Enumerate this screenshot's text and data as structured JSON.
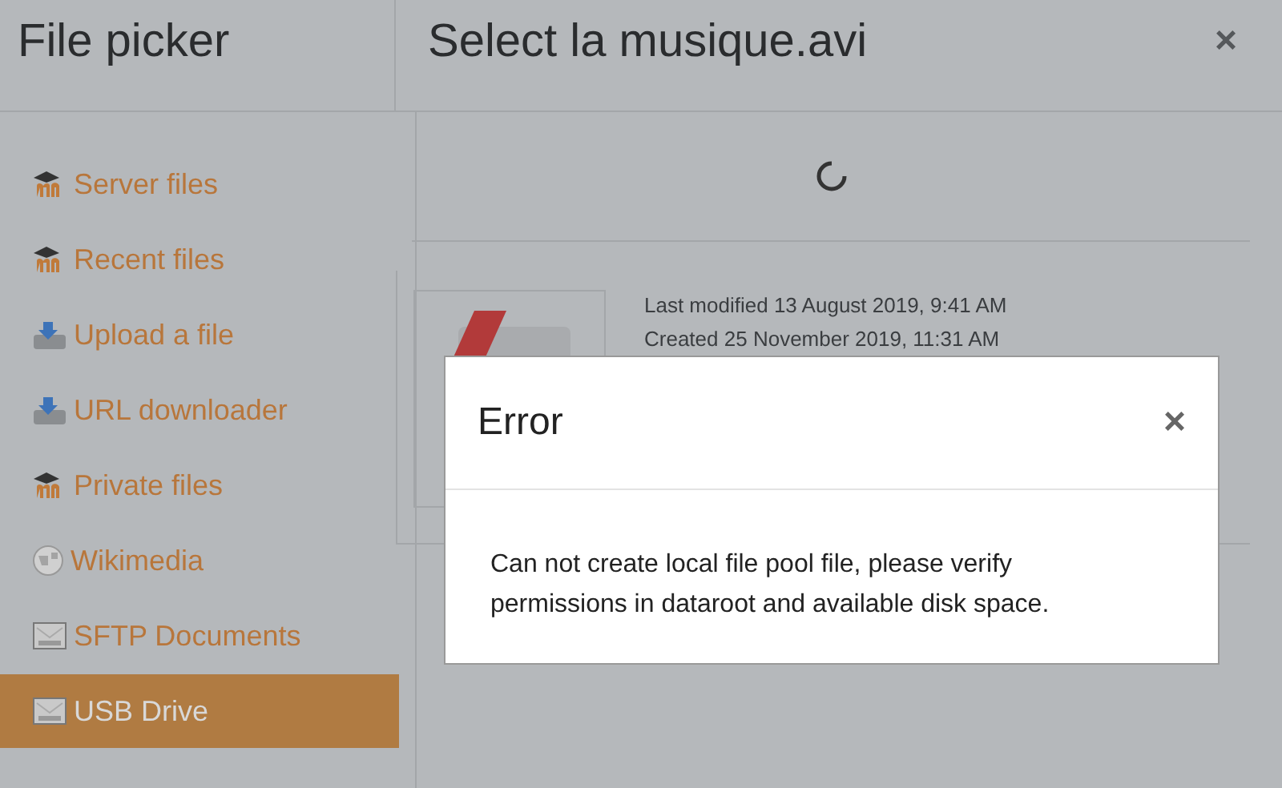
{
  "sidebar": {
    "title": "File picker",
    "items": [
      {
        "label": "Server files",
        "kind": "moodle",
        "selected": false
      },
      {
        "label": "Recent files",
        "kind": "moodle",
        "selected": false
      },
      {
        "label": "Upload a file",
        "kind": "upload",
        "selected": false
      },
      {
        "label": "URL downloader",
        "kind": "upload",
        "selected": false
      },
      {
        "label": "Private files",
        "kind": "moodle",
        "selected": false
      },
      {
        "label": "Wikimedia",
        "kind": "globe",
        "selected": false
      },
      {
        "label": "SFTP Documents",
        "kind": "drive",
        "selected": false
      },
      {
        "label": "USB Drive",
        "kind": "drive",
        "selected": true
      }
    ]
  },
  "panel": {
    "title": "Select la musique.avi",
    "close": "×",
    "loading": true,
    "details": [
      {
        "label": "Last modified",
        "value": "13 August 2019, 9:41 AM"
      },
      {
        "label": "Created",
        "value": "25 November 2019, 11:31 AM"
      }
    ]
  },
  "dialog": {
    "title": "Error",
    "close": "×",
    "message": "Can not create local file pool file, please verify permissions in dataroot and available disk space."
  }
}
